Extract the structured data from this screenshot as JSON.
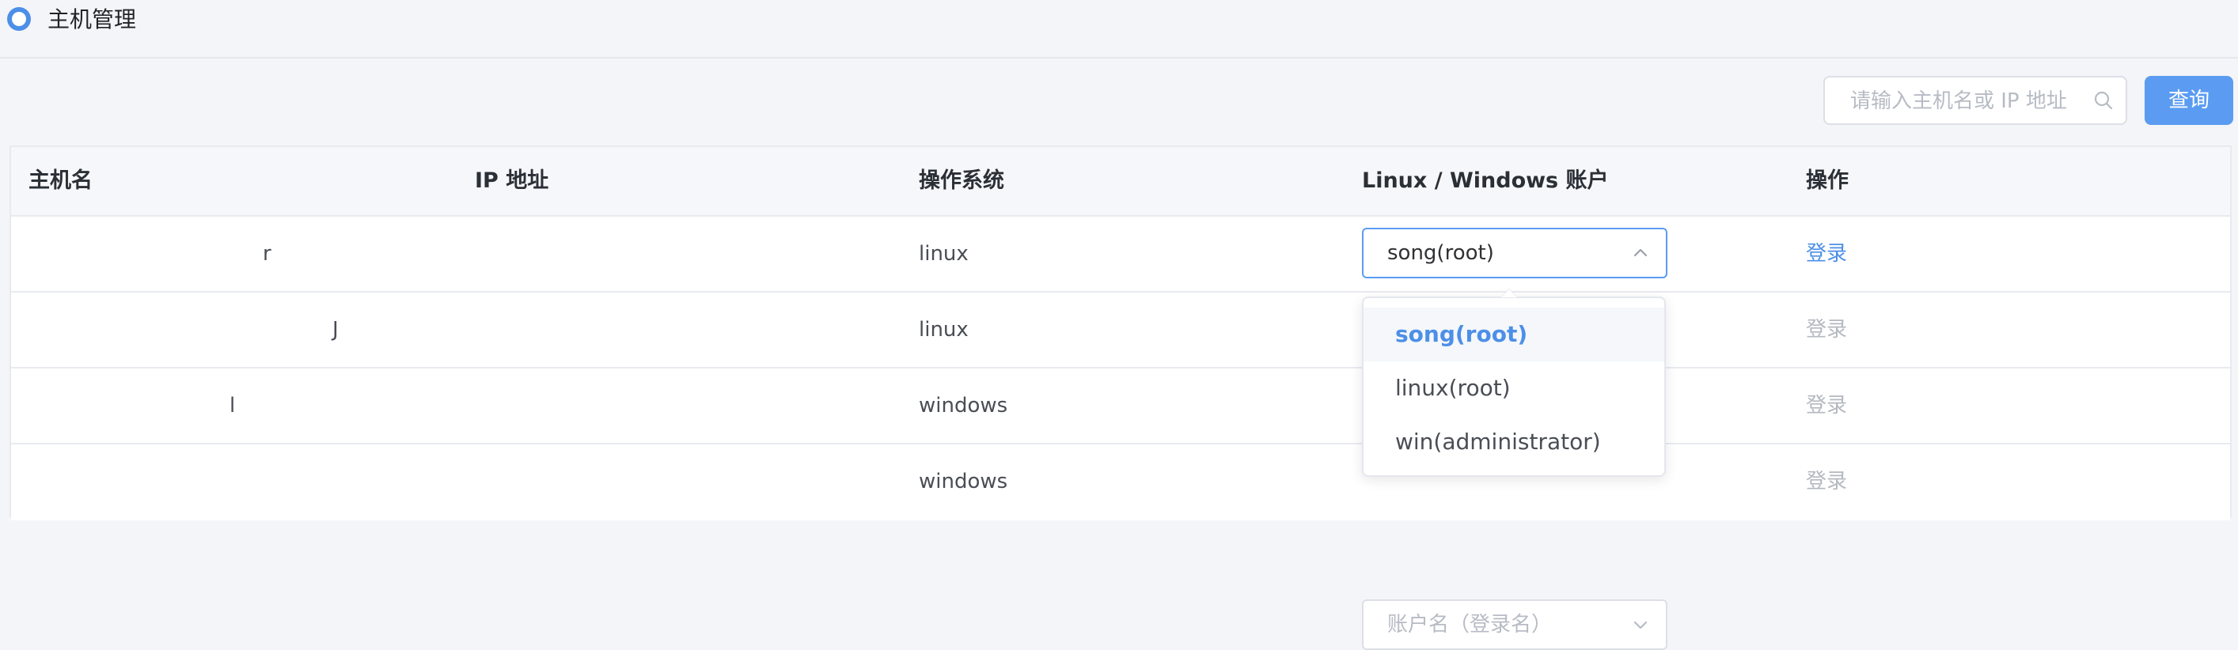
{
  "page": {
    "title": "主机管理"
  },
  "search": {
    "placeholder": "请输入主机名或 IP 地址",
    "value": ""
  },
  "toolbar": {
    "query_label": "查询"
  },
  "table": {
    "headers": [
      "主机名",
      "IP 地址",
      "操作系统",
      "Linux / Windows 账户",
      "操作"
    ],
    "rows": [
      {
        "hostname": "r",
        "ip": "",
        "os": "linux",
        "account": "song(root)",
        "action": "登录",
        "action_enabled": true
      },
      {
        "hostname": "J",
        "ip": "",
        "os": "linux",
        "account": "",
        "action": "登录",
        "action_enabled": false
      },
      {
        "hostname": "l",
        "ip": "",
        "os": "windows",
        "account": "",
        "action": "登录",
        "action_enabled": false
      },
      {
        "hostname": "",
        "ip": "",
        "os": "windows",
        "account_placeholder": "账户名（登录名）",
        "action": "登录",
        "action_enabled": false
      }
    ]
  },
  "account_dropdown": {
    "selected": "song(root)",
    "options": [
      "song(root)",
      "linux(root)",
      "win(administrator)"
    ]
  },
  "colors": {
    "accent": "#4c8fe8",
    "button": "#5b9cf2",
    "disabled_link": "#b4b8bf"
  },
  "icons": {
    "title": "circle-icon",
    "search": "search-icon",
    "select_open": "chevron-up-icon",
    "select_closed": "chevron-down-icon"
  }
}
